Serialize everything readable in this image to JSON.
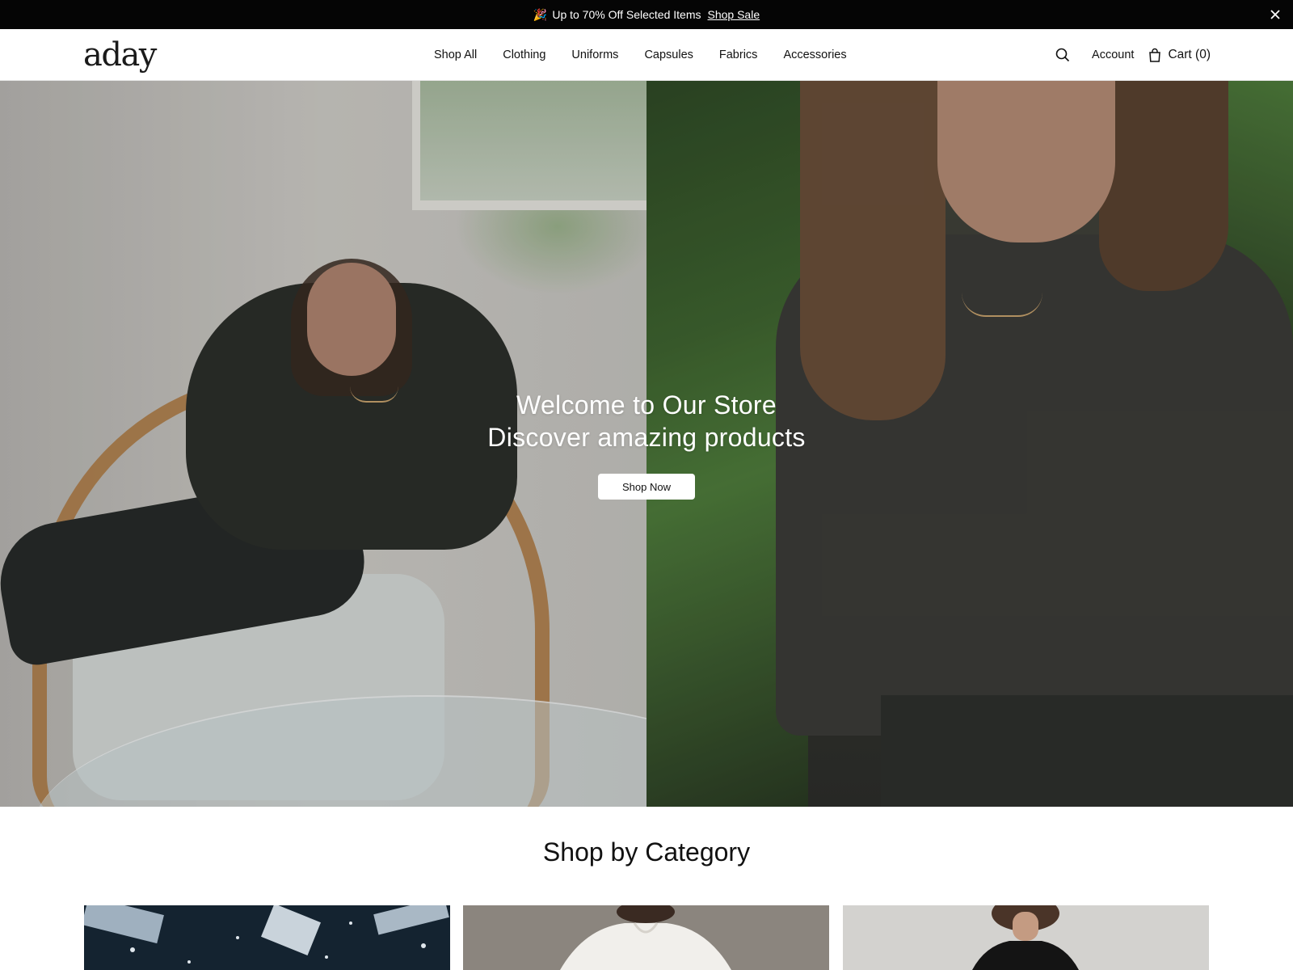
{
  "announcement": {
    "emoji": "🎉",
    "text": "Up to 70% Off Selected Items",
    "link_label": "Shop Sale"
  },
  "header": {
    "logo": "aday",
    "nav": [
      "Shop All",
      "Clothing",
      "Uniforms",
      "Capsules",
      "Fabrics",
      "Accessories"
    ],
    "account_label": "Account",
    "cart_label": "Cart (0)"
  },
  "hero": {
    "line1": "Welcome to Our Store",
    "line2": "Discover amazing products",
    "button_label": "Shop Now"
  },
  "categories": {
    "title": "Shop by Category"
  },
  "icons": {
    "close": "close-icon",
    "search": "search-icon",
    "cart": "shopping-bag-icon"
  },
  "colors": {
    "announcement_bg": "#050505",
    "text": "#111111",
    "button_bg": "#ffffff"
  }
}
